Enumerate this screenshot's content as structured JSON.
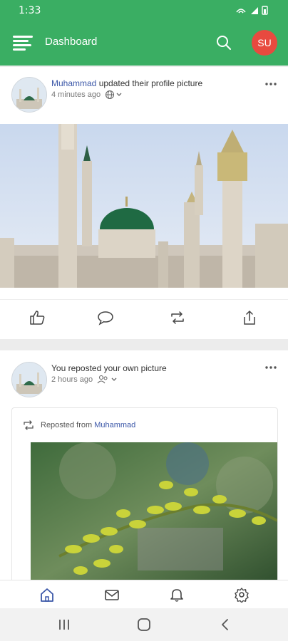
{
  "status_bar": {
    "time": "1:33"
  },
  "app_bar": {
    "title": "Dashboard",
    "avatar_initials": "SU"
  },
  "posts": [
    {
      "author": "Muhammad",
      "action_text": "updated their profile picture",
      "time": "4 minutes ago",
      "privacy_icon": "globe-icon"
    },
    {
      "action_text": "You reposted your own picture",
      "time": "2 hours ago",
      "privacy_icon": "people-icon",
      "repost_prefix": "Reposted from",
      "repost_author": "Muhammad"
    }
  ],
  "colors": {
    "brand": "#3aae63",
    "avatar": "#e84a3f",
    "link": "#3b57a8",
    "active_nav": "#3b57a8"
  }
}
